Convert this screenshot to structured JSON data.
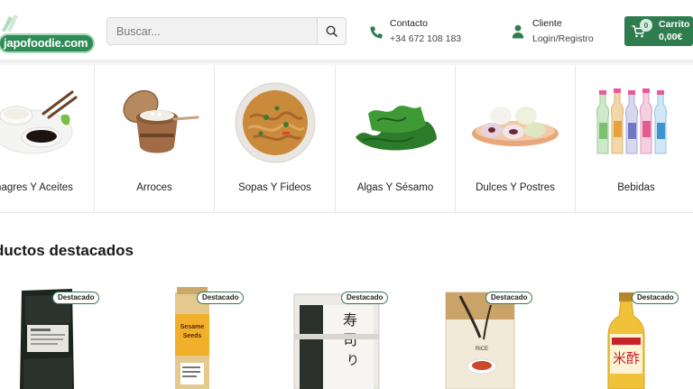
{
  "header": {
    "logo_text": "japofoodie.com",
    "search": {
      "placeholder": "Buscar..."
    },
    "contact": {
      "title": "Contacto",
      "phone": "+34 672 108 183"
    },
    "client": {
      "title": "Cliente",
      "link": "Login/Registro"
    },
    "cart": {
      "title": "Carrito",
      "total": "0,00€",
      "count": "0"
    }
  },
  "categories": [
    {
      "label": "Vinagres Y Aceites",
      "display": "nagres Y Aceites"
    },
    {
      "label": "Arroces"
    },
    {
      "label": "Sopas Y Fideos"
    },
    {
      "label": "Algas Y Sésamo"
    },
    {
      "label": "Dulces Y Postres"
    },
    {
      "label": "Bebidas"
    }
  ],
  "featured": {
    "title_display": "ductos destacados",
    "badge": "Destacado",
    "products": [
      {
        "name": "nori-seaweed-pack"
      },
      {
        "name": "sesame-seeds-jar"
      },
      {
        "name": "sushi-nori-pack"
      },
      {
        "name": "rice-bag"
      },
      {
        "name": "rice-vinegar-bottle"
      }
    ]
  },
  "colors": {
    "brand": "#2f7d4f",
    "badge_border": "#2f7d4f"
  }
}
